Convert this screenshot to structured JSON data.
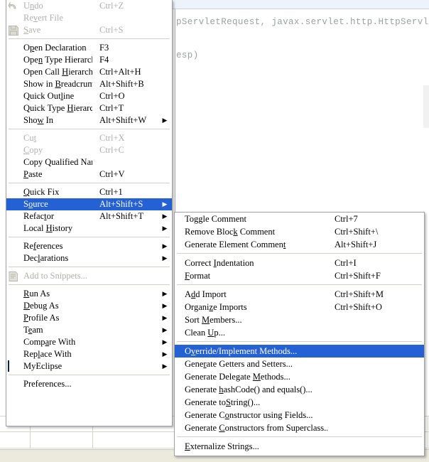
{
  "background": {
    "code_line_1": "pServletRequest, javax.servlet.http.HttpServl",
    "code_line_2": "esp)"
  },
  "context_menu": {
    "name": "editor-context-menu",
    "groups": [
      {
        "items": [
          {
            "label_pre": "U",
            "label_key": "n",
            "label_post": "do",
            "accel": "Ctrl+Z",
            "icon": "undo-icon",
            "disabled": true,
            "submenu": false
          },
          {
            "label_pre": "Re",
            "label_key": "v",
            "label_post": "ert File",
            "accel": "",
            "icon": "",
            "disabled": true,
            "submenu": false
          },
          {
            "label_pre": "",
            "label_key": "S",
            "label_post": "ave",
            "accel": "Ctrl+S",
            "icon": "save-icon",
            "disabled": true,
            "submenu": false
          }
        ]
      },
      {
        "items": [
          {
            "label_pre": "O",
            "label_key": "p",
            "label_post": "en Declaration",
            "accel": "F3",
            "icon": "",
            "disabled": false,
            "submenu": false
          },
          {
            "label_pre": "Ope",
            "label_key": "n",
            "label_post": " Type Hierarchy",
            "accel": "F4",
            "icon": "",
            "disabled": false,
            "submenu": false
          },
          {
            "label_pre": "Open Call ",
            "label_key": "H",
            "label_post": "ierarchy",
            "accel": "Ctrl+Alt+H",
            "icon": "",
            "disabled": false,
            "submenu": false
          },
          {
            "label_pre": "Show in ",
            "label_key": "B",
            "label_post": "readcrumb",
            "accel": "Alt+Shift+B",
            "icon": "",
            "disabled": false,
            "submenu": false
          },
          {
            "label_pre": "Quick Out",
            "label_key": "l",
            "label_post": "ine",
            "accel": "Ctrl+O",
            "icon": "",
            "disabled": false,
            "submenu": false
          },
          {
            "label_pre": "Quick Type ",
            "label_key": "H",
            "label_post": "ierarchy",
            "accel": "Ctrl+T",
            "icon": "",
            "disabled": false,
            "submenu": false
          },
          {
            "label_pre": "Sho",
            "label_key": "w",
            "label_post": " In",
            "accel": "Alt+Shift+W",
            "icon": "",
            "disabled": false,
            "submenu": true
          }
        ]
      },
      {
        "items": [
          {
            "label_pre": "Cu",
            "label_key": "t",
            "label_post": "",
            "accel": "Ctrl+X",
            "icon": "",
            "disabled": true,
            "submenu": false
          },
          {
            "label_pre": "",
            "label_key": "C",
            "label_post": "opy",
            "accel": "Ctrl+C",
            "icon": "",
            "disabled": true,
            "submenu": false
          },
          {
            "label_pre": "Copy Qualified Name",
            "label_key": "",
            "label_post": "",
            "accel": "",
            "icon": "",
            "disabled": false,
            "submenu": false
          },
          {
            "label_pre": "",
            "label_key": "P",
            "label_post": "aste",
            "accel": "Ctrl+V",
            "icon": "",
            "disabled": false,
            "submenu": false
          }
        ]
      },
      {
        "items": [
          {
            "label_pre": "",
            "label_key": "Q",
            "label_post": "uick Fix",
            "accel": "Ctrl+1",
            "icon": "",
            "disabled": false,
            "submenu": false
          },
          {
            "label_pre": "S",
            "label_key": "o",
            "label_post": "urce",
            "accel": "Alt+Shift+S",
            "icon": "",
            "disabled": false,
            "submenu": true,
            "selected": true
          },
          {
            "label_pre": "Refac",
            "label_key": "t",
            "label_post": "or",
            "accel": "Alt+Shift+T",
            "icon": "",
            "disabled": false,
            "submenu": true
          },
          {
            "label_pre": "Local ",
            "label_key": "H",
            "label_post": "istory",
            "accel": "",
            "icon": "",
            "disabled": false,
            "submenu": true
          }
        ]
      },
      {
        "items": [
          {
            "label_pre": "Re",
            "label_key": "f",
            "label_post": "erences",
            "accel": "",
            "icon": "",
            "disabled": false,
            "submenu": true
          },
          {
            "label_pre": "Dec",
            "label_key": "l",
            "label_post": "arations",
            "accel": "",
            "icon": "",
            "disabled": false,
            "submenu": true
          }
        ]
      },
      {
        "items": [
          {
            "label_pre": "Add to Snippets...",
            "label_key": "",
            "label_post": "",
            "accel": "",
            "icon": "snippets-icon",
            "disabled": true,
            "submenu": false
          }
        ]
      },
      {
        "items": [
          {
            "label_pre": "",
            "label_key": "R",
            "label_post": "un As",
            "accel": "",
            "icon": "",
            "disabled": false,
            "submenu": true
          },
          {
            "label_pre": "",
            "label_key": "D",
            "label_post": "ebug As",
            "accel": "",
            "icon": "",
            "disabled": false,
            "submenu": true
          },
          {
            "label_pre": "",
            "label_key": "P",
            "label_post": "rofile As",
            "accel": "",
            "icon": "",
            "disabled": false,
            "submenu": true
          },
          {
            "label_pre": "T",
            "label_key": "e",
            "label_post": "am",
            "accel": "",
            "icon": "",
            "disabled": false,
            "submenu": true
          },
          {
            "label_pre": "Comp",
            "label_key": "a",
            "label_post": "re With",
            "accel": "",
            "icon": "",
            "disabled": false,
            "submenu": true
          },
          {
            "label_pre": "Rep",
            "label_key": "l",
            "label_post": "ace With",
            "accel": "",
            "icon": "",
            "disabled": false,
            "submenu": true
          },
          {
            "label_pre": "MyEclipse",
            "label_key": "",
            "label_post": "",
            "accel": "",
            "icon": "myeclipse-icon",
            "disabled": false,
            "submenu": true
          }
        ]
      },
      {
        "items": [
          {
            "label_pre": "Preferences...",
            "label_key": "",
            "label_post": "",
            "accel": "",
            "icon": "",
            "disabled": false,
            "submenu": false
          }
        ]
      }
    ]
  },
  "source_submenu": {
    "name": "source-submenu",
    "groups": [
      {
        "items": [
          {
            "label_pre": "Tog",
            "label_key": "g",
            "label_post": "le Comment",
            "accel": "Ctrl+7",
            "disabled": false
          },
          {
            "label_pre": "Remove Bloc",
            "label_key": "k",
            "label_post": " Comment",
            "accel": "Ctrl+Shift+\\",
            "disabled": false
          },
          {
            "label_pre": "Generate Element Commen",
            "label_key": "t",
            "label_post": "",
            "accel": "Alt+Shift+J",
            "disabled": false
          }
        ]
      },
      {
        "items": [
          {
            "label_pre": "Correct ",
            "label_key": "I",
            "label_post": "ndentation",
            "accel": "Ctrl+I",
            "disabled": false
          },
          {
            "label_pre": "",
            "label_key": "F",
            "label_post": "ormat",
            "accel": "Ctrl+Shift+F",
            "disabled": false
          }
        ]
      },
      {
        "items": [
          {
            "label_pre": "A",
            "label_key": "d",
            "label_post": "d Import",
            "accel": "Ctrl+Shift+M",
            "disabled": false
          },
          {
            "label_pre": "Organi",
            "label_key": "z",
            "label_post": "e Imports",
            "accel": "Ctrl+Shift+O",
            "disabled": false
          },
          {
            "label_pre": "Sort ",
            "label_key": "M",
            "label_post": "embers...",
            "accel": "",
            "disabled": false
          },
          {
            "label_pre": "Clean ",
            "label_key": "U",
            "label_post": "p...",
            "accel": "",
            "disabled": false
          }
        ]
      },
      {
        "items": [
          {
            "label_pre": "O",
            "label_key": "v",
            "label_post": "erride/Implement Methods...",
            "accel": "",
            "disabled": false,
            "selected": true
          },
          {
            "label_pre": "Gene",
            "label_key": "r",
            "label_post": "ate Getters and Setters...",
            "accel": "",
            "disabled": false
          },
          {
            "label_pre": "Generate Delegate ",
            "label_key": "M",
            "label_post": "ethods...",
            "accel": "",
            "disabled": false
          },
          {
            "label_pre": "Generate ",
            "label_key": "h",
            "label_post": "ashCode() and equals()...",
            "accel": "",
            "disabled": false
          },
          {
            "label_pre": "Generate to",
            "label_key": "S",
            "label_post": "tring()...",
            "accel": "",
            "disabled": false
          },
          {
            "label_pre": "Generate C",
            "label_key": "o",
            "label_post": "nstructor using Fields...",
            "accel": "",
            "disabled": false
          },
          {
            "label_pre": "Generate ",
            "label_key": "C",
            "label_post": "onstructors from Superclass...",
            "accel": "",
            "disabled": false
          }
        ]
      },
      {
        "items": [
          {
            "label_pre": "",
            "label_key": "E",
            "label_post": "xternalize Strings...",
            "accel": "",
            "disabled": false
          }
        ]
      }
    ]
  },
  "colors": {
    "selection_blue": "#2361d4",
    "menu_bg": "#ffffff",
    "disabled_text": "#b0b0ae",
    "separator": "#d4d0c8"
  }
}
